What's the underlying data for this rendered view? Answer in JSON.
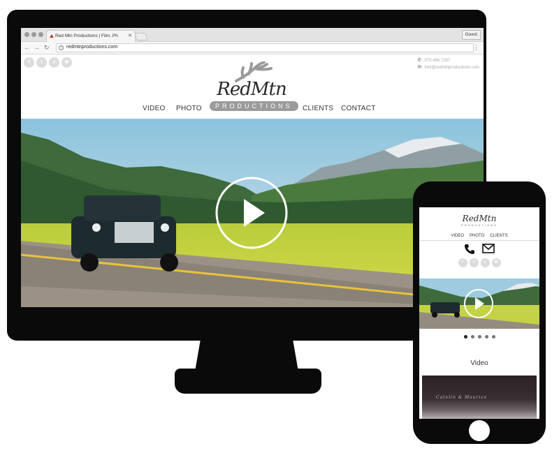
{
  "browser": {
    "tab_title": "Red Mtn Productions | Film, Ph",
    "tab_close": "✕",
    "guest_label": "Guest",
    "url": "redmtnproductions.com",
    "back": "←",
    "forward": "→",
    "reload": "↻",
    "menu": "⋮"
  },
  "site": {
    "social": [
      "f",
      "t",
      "v",
      "✉"
    ],
    "phone": "970.456.7297",
    "email": "info@redmtnproductions.com",
    "logo_main": "RedMtn",
    "logo_sub": "PRODUCTIONS",
    "nav": [
      {
        "label": "VIDEO"
      },
      {
        "label": "PHOTO"
      },
      {
        "label": "CLIENTS"
      },
      {
        "label": "CONTACT"
      }
    ]
  },
  "mobile": {
    "logo_main": "RedMtn",
    "logo_sub": "PRODUCTIONS",
    "nav": [
      "VIDEO",
      "PHOTO",
      "CLIENTS"
    ],
    "social": [
      "f",
      "t",
      "v",
      "✉"
    ],
    "carousel_dots": 5,
    "active_dot": 0,
    "section_title": "Video",
    "thumb_text": "Catelin & Maurice"
  },
  "colors": {
    "device": "#0a0a0a",
    "sky": "#a9cfe2",
    "grass": "#c9d84a",
    "mountain": "#3d6a3a"
  }
}
